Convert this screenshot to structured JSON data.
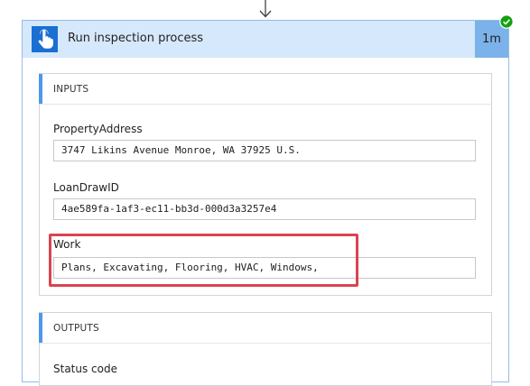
{
  "step": {
    "title": "Run inspection process",
    "duration": "1m",
    "trigger_icon": "hand-pointer-icon",
    "status_icon": "success-check-icon",
    "accent_color": "#1a6fd3",
    "header_color": "#d6e8fb",
    "status_color": "#13a10e"
  },
  "inputs": {
    "title": "INPUTS",
    "fields": [
      {
        "label": "PropertyAddress",
        "value": "3747 Likins Avenue Monroe, WA 37925 U.S."
      },
      {
        "label": "LoanDrawID",
        "value": "4ae589fa-1af3-ec11-bb3d-000d3a3257e4"
      },
      {
        "label": "Work",
        "value": "Plans, Excavating, Flooring, HVAC, Windows,"
      }
    ]
  },
  "outputs": {
    "title": "OUTPUTS",
    "fields": [
      {
        "label": "Status code"
      }
    ]
  },
  "annotation": {
    "highlight_color": "#d9444f"
  }
}
